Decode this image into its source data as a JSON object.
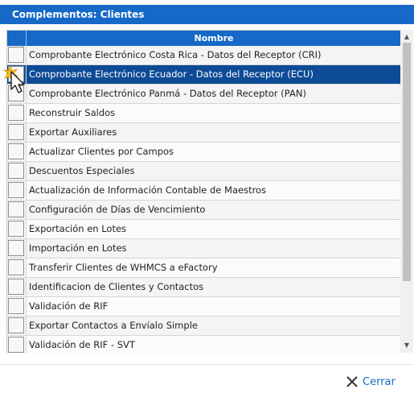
{
  "window": {
    "title": "Complementos: Clientes"
  },
  "grid": {
    "column_header": "Nombre",
    "selected_index": 1,
    "rows": [
      {
        "label": "Comprobante Electrónico Costa Rica - Datos del Receptor (CRI)"
      },
      {
        "label": "Comprobante Electrónico Ecuador - Datos del Receptor (ECU)"
      },
      {
        "label": "Comprobante Electrónico Panmá - Datos del Receptor (PAN)"
      },
      {
        "label": "Reconstruir Saldos"
      },
      {
        "label": "Exportar Auxiliares"
      },
      {
        "label": "Actualizar Clientes por Campos"
      },
      {
        "label": "Descuentos Especiales"
      },
      {
        "label": "Actualización de Información Contable de Maestros"
      },
      {
        "label": "Configuración de Días de Vencimiento"
      },
      {
        "label": "Exportación en Lotes"
      },
      {
        "label": "Importación en Lotes"
      },
      {
        "label": "Transferir Clientes de WHMCS a eFactory"
      },
      {
        "label": "Identificacion de Clientes y Contactos"
      },
      {
        "label": "Validación de RIF"
      },
      {
        "label": "Exportar Contactos a Envíalo Simple"
      },
      {
        "label": "Validación de RIF - SVT"
      }
    ]
  },
  "footer": {
    "close_label": "Cerrar"
  },
  "colors": {
    "accent": "#1669c6",
    "selected_row": "#0e4b96"
  },
  "icons": {
    "close": "close-x-icon",
    "cursor": "mouse-pointer-icon"
  }
}
